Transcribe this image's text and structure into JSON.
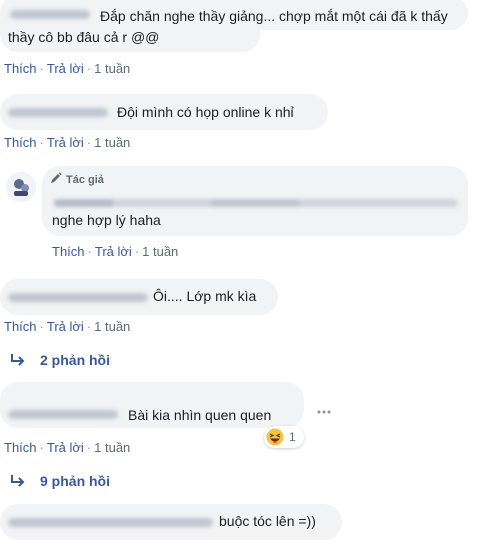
{
  "comments": [
    {
      "text": "Đắp chăn nghe thầy giảng... chợp mắt một cái đã k thấy thầy cô bb đâu cả r @@"
    },
    {
      "text": "Đội mình có họp online k nhỉ"
    },
    {
      "author_badge": "Tác giả",
      "text": "nghe hợp lý haha"
    },
    {
      "text": "Ôi.... Lớp mk kìa"
    },
    {
      "text": "Bài kia nhìn quen quen",
      "reaction_count": "1"
    },
    {
      "text": "buộc tóc lên =))"
    }
  ],
  "actions": {
    "like": "Thích",
    "reply": "Trả lời",
    "time": "1 tuần",
    "sep": "·"
  },
  "replies": [
    {
      "label": "2 phản hồi"
    },
    {
      "label": "9 phản hồi"
    }
  ],
  "colors": {
    "link": "#385898",
    "bubble": "#f2f3f5",
    "meta": "#606770"
  },
  "icons": [
    "reply-arrow-icon",
    "pencil-icon",
    "laugh-reaction-icon",
    "more-options-icon",
    "avatar"
  ]
}
